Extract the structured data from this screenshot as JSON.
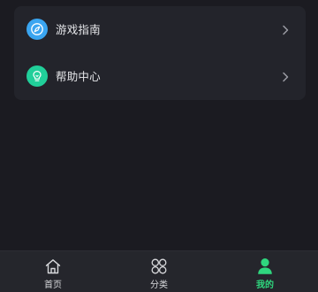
{
  "colors": {
    "background": "#1b1b21",
    "card": "#23242b",
    "tabbar": "#25262c",
    "accent_green": "#2fd67e",
    "guide_icon_blue": "#3aa5f0",
    "help_icon_green": "#21cf9a"
  },
  "menu": {
    "items": [
      {
        "label": "游戏指南",
        "icon": "compass-icon"
      },
      {
        "label": "帮助中心",
        "icon": "lightbulb-icon"
      }
    ]
  },
  "tabbar": {
    "tabs": [
      {
        "label": "首页",
        "icon": "home-icon",
        "active": false
      },
      {
        "label": "分类",
        "icon": "category-grid-icon",
        "active": false
      },
      {
        "label": "我的",
        "icon": "user-profile-icon",
        "active": true
      }
    ]
  }
}
